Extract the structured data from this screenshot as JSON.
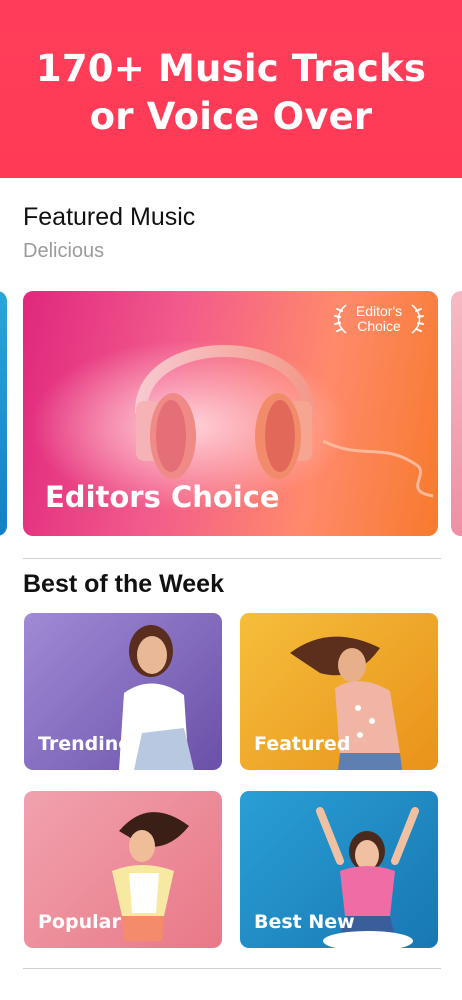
{
  "hero": {
    "title_line1": "170+ Music Tracks",
    "title_line2": "or Voice Over"
  },
  "featured": {
    "title": "Featured Music",
    "subtitle": "Delicious"
  },
  "main_card": {
    "label": "Editors Choice",
    "badge_line1": "Editor's",
    "badge_line2": "Choice"
  },
  "best_of_week": {
    "title": "Best of the Week",
    "tiles": [
      {
        "label": "Trending",
        "color": "#8a6bc4"
      },
      {
        "label": "Featured",
        "color": "#f2ad27"
      },
      {
        "label": "Popular",
        "color": "#ee8a9b"
      },
      {
        "label": "Best New",
        "color": "#1f8fc6"
      }
    ]
  }
}
